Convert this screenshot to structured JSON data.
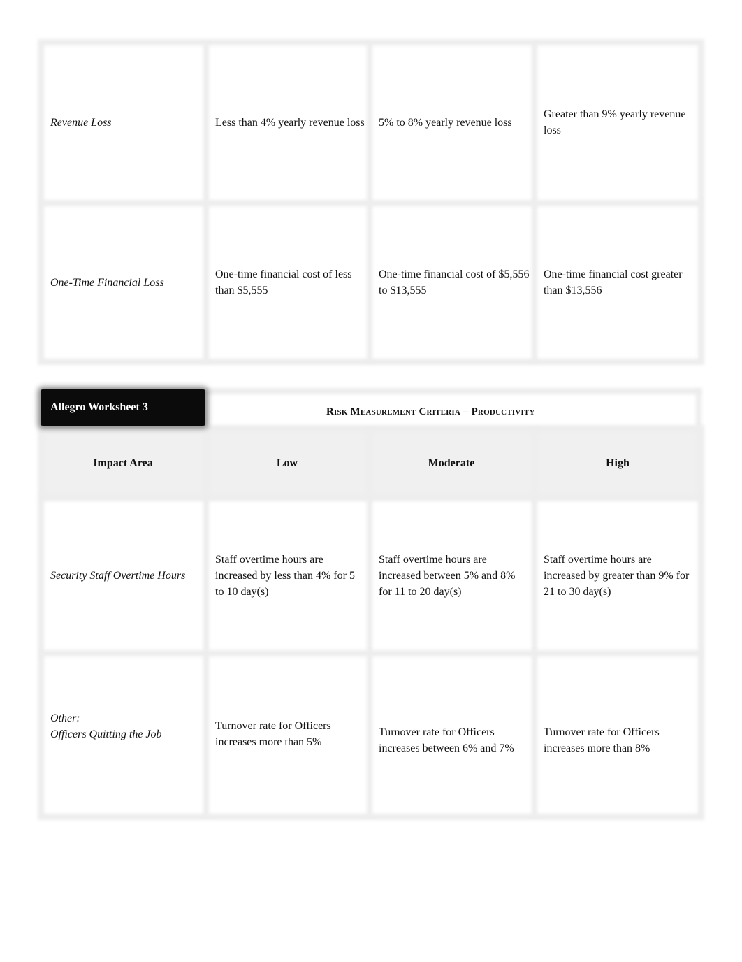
{
  "table_continued": {
    "rows": [
      {
        "impact_area": "Revenue Loss",
        "low": "Less than 4% yearly revenue loss",
        "moderate": "5% to 8% yearly revenue loss",
        "high": "Greater than 9% yearly revenue loss"
      },
      {
        "impact_area": "One-Time Financial Loss",
        "low": "One-time financial cost of less than $5,555",
        "moderate": "One-time financial cost of $5,556 to $13,555",
        "high": "One-time financial cost greater than $13,556"
      }
    ]
  },
  "worksheet": {
    "label": "Allegro Worksheet 3",
    "title": "Risk Measurement Criteria – Productivity",
    "headers": {
      "impact_area": "Impact Area",
      "low": "Low",
      "moderate": "Moderate",
      "high": "High"
    },
    "rows": [
      {
        "impact_area": "Security Staff Overtime Hours",
        "low": "Staff overtime hours are increased by less than 4% for 5 to 10 day(s)",
        "moderate": "Staff overtime hours are increased between 5% and 8% for 11 to 20 day(s)",
        "high": "Staff overtime hours are increased by greater than 9% for 21 to 30 day(s)"
      },
      {
        "impact_area_prefix": "Other:",
        "impact_area": "Officers Quitting the Job",
        "low": "Turnover rate for Officers increases more than 5%",
        "moderate": "Turnover rate for Officers increases between 6% and 7%",
        "high": "Turnover rate for Officers increases more than 8%"
      }
    ]
  }
}
